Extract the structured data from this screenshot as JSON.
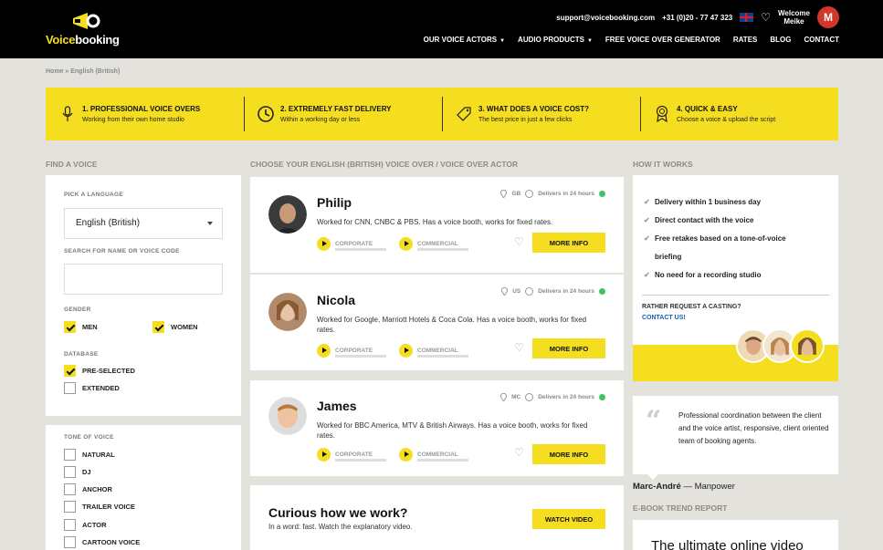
{
  "header": {
    "logo": {
      "part1": "Voice",
      "part2": "booking"
    },
    "email": "support@voicebooking.com",
    "phone": "+31 (0)20 - 77 47 323",
    "welcome_line1": "Welcome",
    "welcome_line2": "Meike",
    "avatar_initial": "M",
    "nav": [
      {
        "label": "OUR VOICE ACTORS",
        "dropdown": true
      },
      {
        "label": "AUDIO PRODUCTS",
        "dropdown": true
      },
      {
        "label": "FREE VOICE OVER GENERATOR",
        "dropdown": false
      },
      {
        "label": "RATES",
        "dropdown": false
      },
      {
        "label": "BLOG",
        "dropdown": false
      },
      {
        "label": "CONTACT",
        "dropdown": false
      }
    ]
  },
  "breadcrumb": "Home » English (British)",
  "benefits": [
    {
      "title": "1. PROFESSIONAL VOICE OVERS",
      "subtitle": "Working from their own home studio",
      "icon": "microphone-icon"
    },
    {
      "title": "2. EXTREMELY FAST DELIVERY",
      "subtitle": "Within a working day or less",
      "icon": "clock-icon"
    },
    {
      "title": "3. WHAT DOES A VOICE COST?",
      "subtitle": "The best price in just a few clicks",
      "icon": "price-tag-icon"
    },
    {
      "title": "4. QUICK & EASY",
      "subtitle": "Choose a voice & upload the script",
      "icon": "award-icon"
    }
  ],
  "sections": {
    "find_voice": "FIND A VOICE",
    "choose": "CHOOSE YOUR ENGLISH (BRITISH) VOICE OVER / VOICE OVER ACTOR",
    "how_it_works": "HOW IT WORKS",
    "ebook": "E-BOOK TREND REPORT"
  },
  "filter": {
    "language_label": "PICK A LANGUAGE",
    "language_value": "English (British)",
    "search_label": "SEARCH FOR NAME OR VOICE CODE",
    "search_value": "",
    "gender_label": "GENDER",
    "men": "MEN",
    "women": "WOMEN",
    "database_label": "DATABASE",
    "preselected": "PRE-SELECTED",
    "extended": "EXTENDED"
  },
  "tone": {
    "label": "TONE OF VOICE",
    "options": [
      "NATURAL",
      "DJ",
      "ANCHOR",
      "TRAILER VOICE",
      "ACTOR",
      "CARTOON VOICE"
    ]
  },
  "voices": [
    {
      "name": "Philip",
      "country": "GB",
      "delivery": "Delivers in 24 hours",
      "description": "Worked for CNN, CNBC & PBS. Has a voice booth, works for fixed rates.",
      "sample1": "CORPORATE",
      "sample2": "COMMERCIAL",
      "button": "MORE INFO"
    },
    {
      "name": "Nicola",
      "country": "US",
      "delivery": "Delivers in 24 hours",
      "description": "Worked for Google, Marriott Hotels & Coca Cola. Has a voice booth, works for fixed rates.",
      "sample1": "CORPORATE",
      "sample2": "COMMERCIAL",
      "button": "MORE INFO"
    },
    {
      "name": "James",
      "country": "MC",
      "delivery": "Delivers in 24 hours",
      "description": "Worked for BBC America, MTV & British Airways. Has a voice booth, works for fixed rates.",
      "sample1": "CORPORATE",
      "sample2": "COMMERCIAL",
      "button": "MORE INFO"
    }
  ],
  "curious": {
    "title": "Curious how we work?",
    "subtitle": "In a word: fast. Watch the explanatory video.",
    "button": "WATCH VIDEO"
  },
  "how": {
    "items": [
      "Delivery within 1 business day",
      "Direct contact with the voice",
      "Free retakes based on a tone-of-voice",
      "briefing",
      "No need for a recording studio"
    ],
    "casting": "RATHER REQUEST A CASTING?",
    "contact": "CONTACT US!"
  },
  "testimonial": {
    "quote": "Professional coordination between the client and the voice artist, responsive, client oriented team of booking agents.",
    "author": "Marc-André",
    "company": "— Manpower"
  },
  "ebook": {
    "title": "The ultimate online video"
  },
  "colors": {
    "accent": "#f5de1f",
    "header": "#000000",
    "background": "#e4e2dc",
    "link": "#1a5fb4",
    "online": "#3ec264"
  }
}
